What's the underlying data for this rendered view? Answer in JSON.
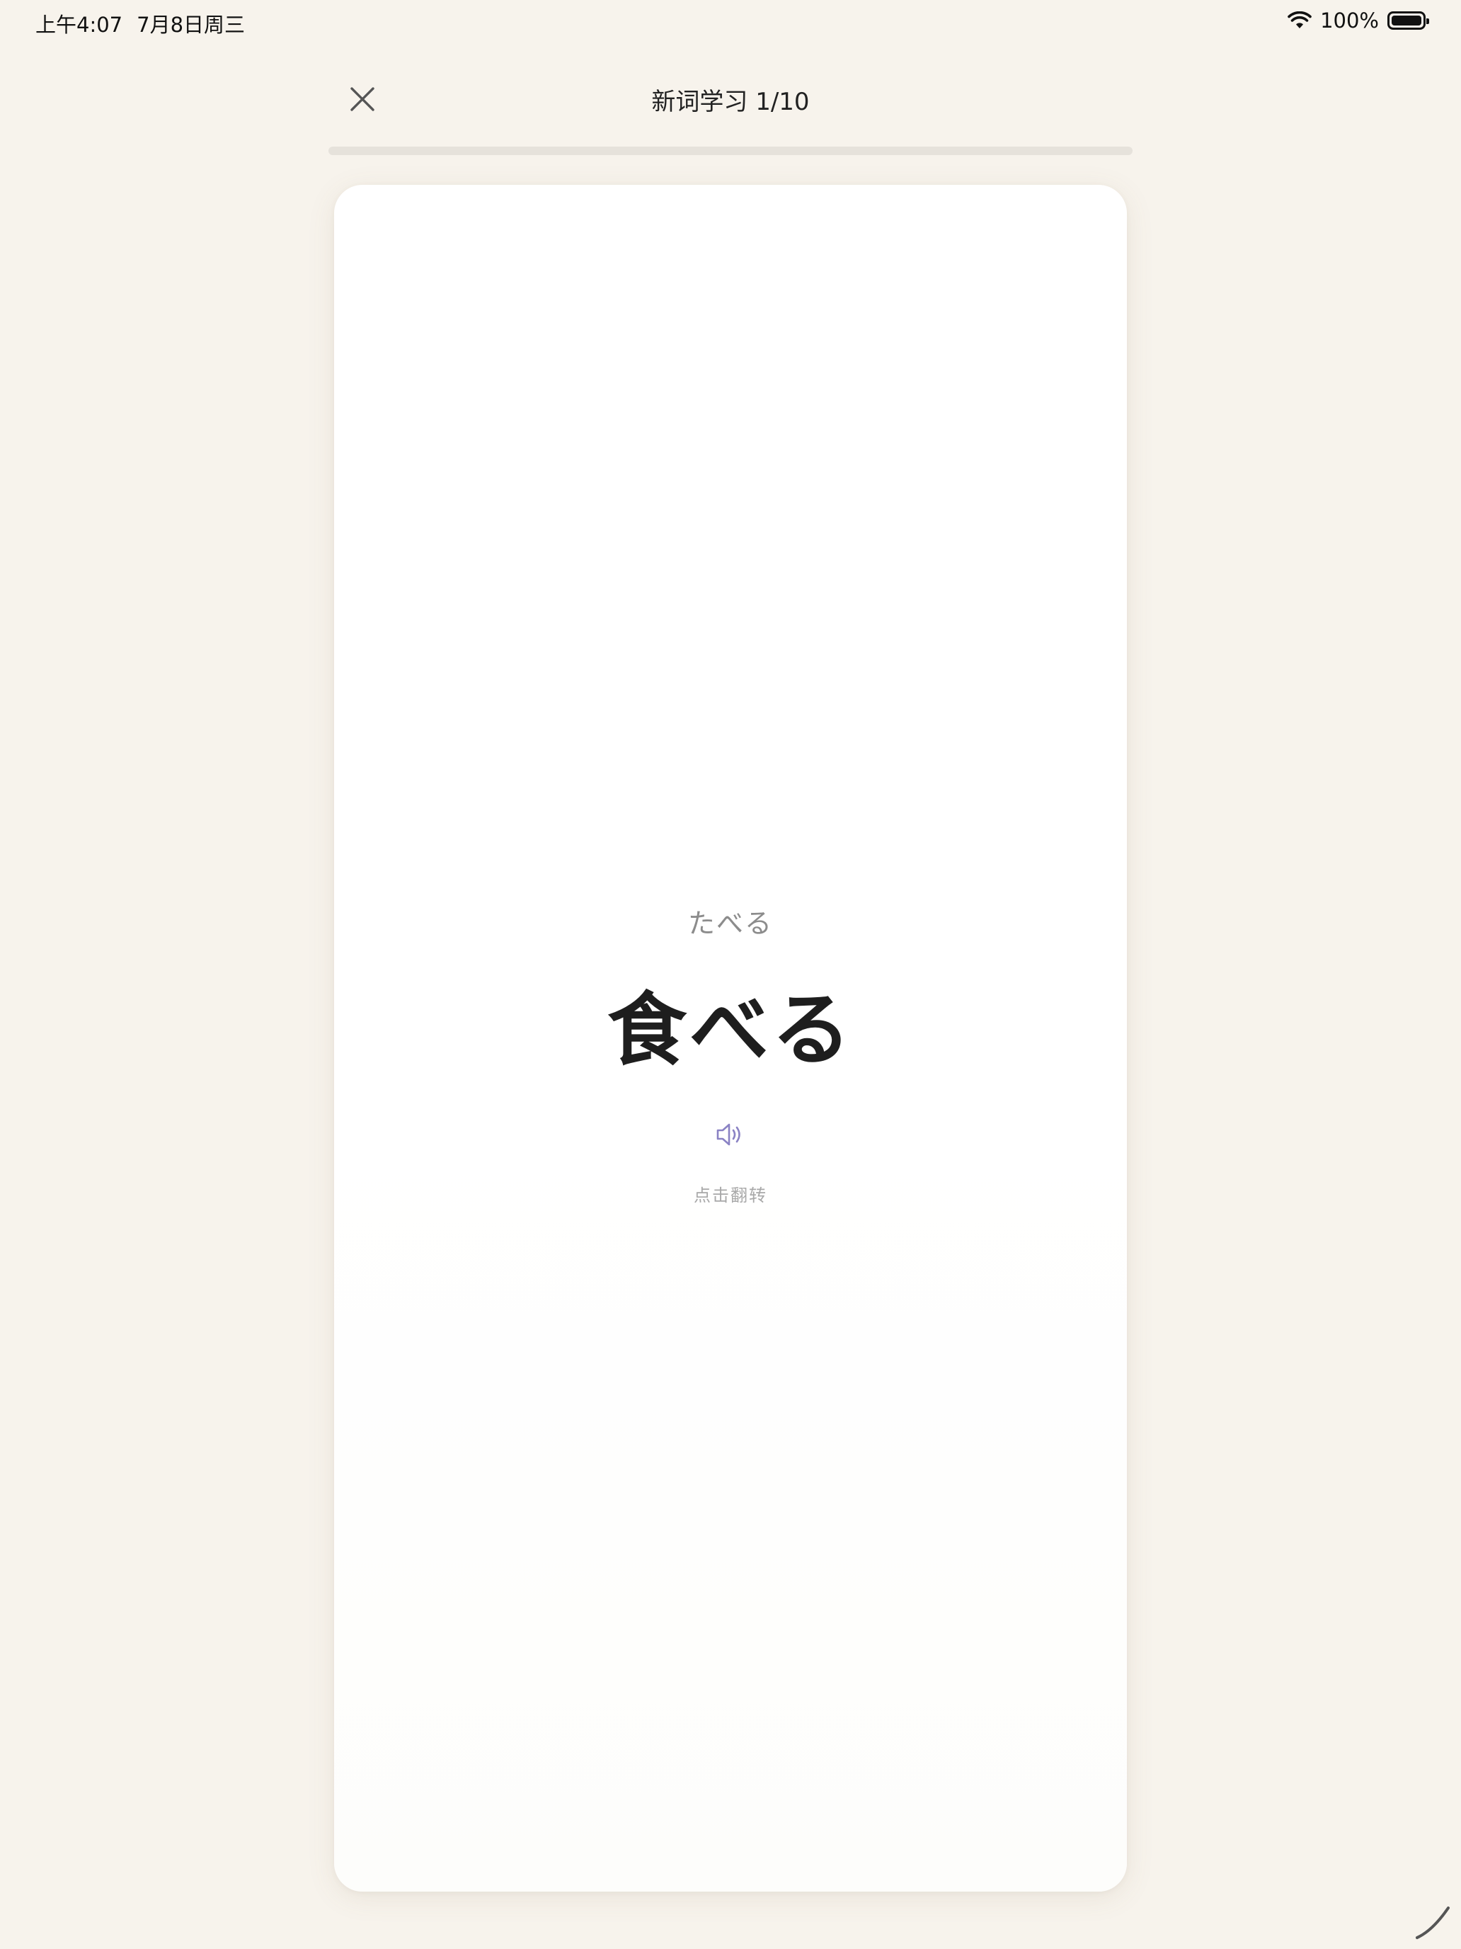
{
  "status_bar": {
    "time": "上午4:07",
    "date": "7月8日周三",
    "battery": "100%"
  },
  "header": {
    "title": "新词学习 1/10"
  },
  "progress": {
    "current": 1,
    "total": 10,
    "fraction": 0
  },
  "card": {
    "reading": "たべる",
    "word": "食べる",
    "flip_hint": "点击翻转"
  },
  "icons": {
    "close": "close-icon",
    "audio": "speaker-icon",
    "wifi": "wifi-icon",
    "battery": "battery-icon"
  },
  "colors": {
    "background": "#f7f3ec",
    "card": "#ffffff",
    "accent_audio": "#8a82c4"
  }
}
